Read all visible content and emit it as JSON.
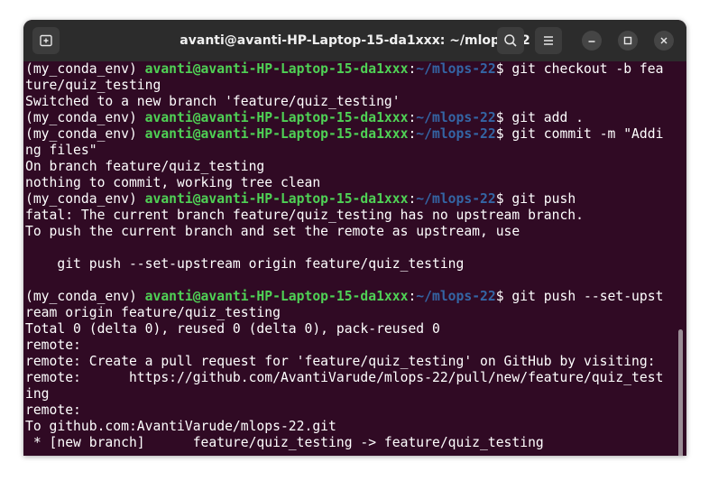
{
  "window": {
    "title": "avanti@avanti-HP-Laptop-15-da1xxx: ~/mlops-22"
  },
  "icons": {
    "new_tab": "new-tab-icon",
    "search": "search-icon",
    "menu": "hamburger-menu-icon",
    "minimize": "minimize-icon",
    "maximize": "maximize-icon",
    "close": "close-icon"
  },
  "colors": {
    "terminal_bg": "#300a24",
    "user_host": "#4fd155",
    "path": "#3465a4",
    "text": "#ffffff",
    "titlebar": "#2c2c2c"
  },
  "terminal": {
    "prompt": {
      "env": "(my_conda_env) ",
      "user_host": "avanti@avanti-HP-Laptop-15-da1xxx",
      "sep": ":",
      "path": "~/mlops-22",
      "dollar": "$"
    },
    "lines": {
      "l0_cmd": " git checkout -b fea",
      "l1": "ture/quiz_testing",
      "l2": "Switched to a new branch 'feature/quiz_testing'",
      "l3_cmd": " git add .",
      "l4_cmd": " git commit -m \"Addi",
      "l5": "ng files\"",
      "l6": "On branch feature/quiz_testing",
      "l7": "nothing to commit, working tree clean",
      "l8_cmd": " git push",
      "l9": "fatal: The current branch feature/quiz_testing has no upstream branch.",
      "l10": "To push the current branch and set the remote as upstream, use",
      "l11": "",
      "l12": "    git push --set-upstream origin feature/quiz_testing",
      "l13": "",
      "l14_cmd": " git push --set-upst",
      "l15": "ream origin feature/quiz_testing",
      "l16": "Total 0 (delta 0), reused 0 (delta 0), pack-reused 0",
      "l17": "remote: ",
      "l18": "remote: Create a pull request for 'feature/quiz_testing' on GitHub by visiting:",
      "l19": "remote:      https://github.com/AvantiVarude/mlops-22/pull/new/feature/quiz_test",
      "l20": "ing",
      "l21": "remote: ",
      "l22": "To github.com:AvantiVarude/mlops-22.git",
      "l23": " * [new branch]      feature/quiz_testing -> feature/quiz_testing"
    }
  }
}
